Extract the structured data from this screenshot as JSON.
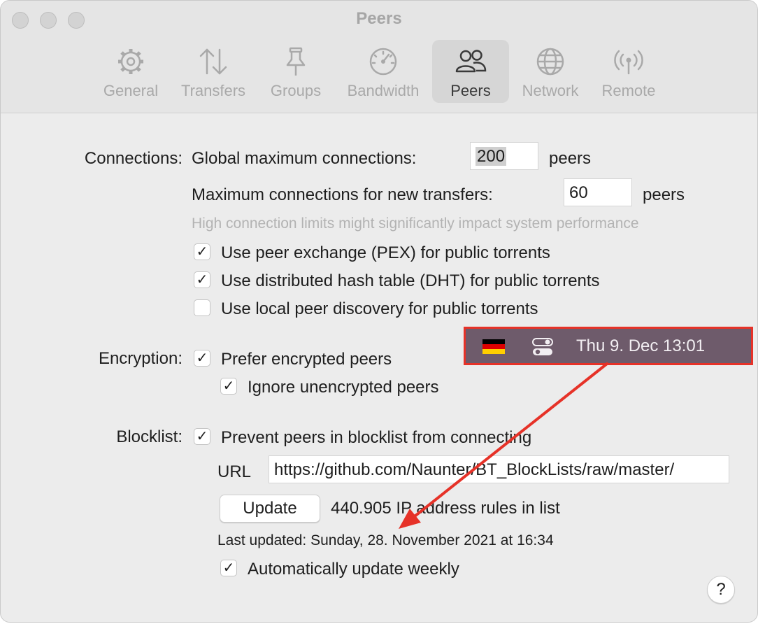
{
  "window": {
    "title": "Peers"
  },
  "tabs": [
    {
      "label": "General",
      "icon": "gear-icon"
    },
    {
      "label": "Transfers",
      "icon": "arrows-up-down-icon"
    },
    {
      "label": "Groups",
      "icon": "pin-icon"
    },
    {
      "label": "Bandwidth",
      "icon": "speedometer-icon"
    },
    {
      "label": "Peers",
      "icon": "people-icon",
      "active": true
    },
    {
      "label": "Network",
      "icon": "globe-icon"
    },
    {
      "label": "Remote",
      "icon": "antenna-icon"
    }
  ],
  "connections": {
    "section_label": "Connections:",
    "global_label": "Global maximum connections:",
    "global_value": "200",
    "global_unit": "peers",
    "new_label": "Maximum connections for new transfers:",
    "new_value": "60",
    "new_unit": "peers",
    "hint": "High connection limits might significantly impact system performance",
    "pex": {
      "label": "Use peer exchange (PEX) for public torrents",
      "checked": true
    },
    "dht": {
      "label": "Use distributed hash table (DHT) for public torrents",
      "checked": true
    },
    "lpd": {
      "label": "Use local peer discovery for public torrents",
      "checked": false
    }
  },
  "encryption": {
    "section_label": "Encryption:",
    "prefer": {
      "label": "Prefer encrypted peers",
      "checked": true
    },
    "ignore": {
      "label": "Ignore unencrypted peers",
      "checked": true
    }
  },
  "blocklist": {
    "section_label": "Blocklist:",
    "prevent": {
      "label": "Prevent peers in blocklist from connecting",
      "checked": true
    },
    "url_label": "URL",
    "url_value": "https://github.com/Naunter/BT_BlockLists/raw/master/",
    "update_button": "Update",
    "rules_count": "440.905 IP address rules in list",
    "last_updated": "Last updated: Sunday, 28. November 2021 at 16:34",
    "auto_update": {
      "label": "Automatically update weekly",
      "checked": true
    }
  },
  "help_button": "?",
  "menubar_overlay": {
    "flag_icon": "german-flag-icon",
    "control_icon": "control-center-icon",
    "clock": "Thu 9. Dec  13:01",
    "highlight_color": "#e63228"
  },
  "checkmark": "✓"
}
